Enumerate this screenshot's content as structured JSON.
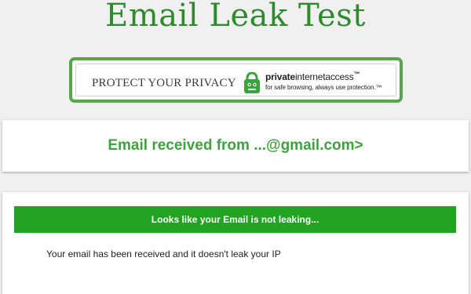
{
  "page": {
    "title": "Email Leak Test"
  },
  "ad_banner": {
    "tagline": "PROTECT YOUR PRIVACY",
    "brand_bold": "private",
    "brand_rest": "internetaccess",
    "brand_tm": "™",
    "slogan": "for safe browsing, always use protection.™",
    "icon": "pia-lock-icon"
  },
  "received": {
    "text": "Email received from ...@gmail.com>"
  },
  "result": {
    "status": "Looks like your Email is not leaking...",
    "message": "Your email has been received and it doesn't leak your IP"
  },
  "colors": {
    "title_green": "#2f8a2f",
    "status_bar_green": "#22a322",
    "banner_border_green": "#55a84a",
    "received_text_green": "#3ea33e",
    "page_background": "#f0f0f0"
  }
}
